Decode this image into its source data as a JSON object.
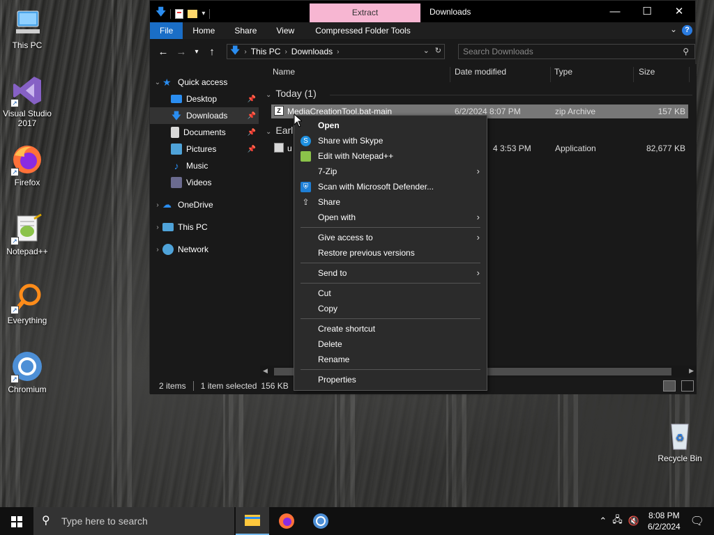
{
  "desktop": {
    "icons": [
      {
        "label": "This PC"
      },
      {
        "label": "Visual Studio 2017"
      },
      {
        "label": "Firefox"
      },
      {
        "label": "Notepad++"
      },
      {
        "label": "Everything"
      },
      {
        "label": "Chromium"
      },
      {
        "label": "Recycle Bin"
      }
    ]
  },
  "explorer": {
    "title": "Downloads",
    "contextual_tab": "Extract",
    "ribbon_tabs": [
      "File",
      "Home",
      "Share",
      "View",
      "Compressed Folder Tools"
    ],
    "breadcrumb": [
      "This PC",
      "Downloads"
    ],
    "search_placeholder": "Search Downloads",
    "nav": {
      "quick_access": "Quick access",
      "items": [
        "Desktop",
        "Downloads",
        "Documents",
        "Pictures",
        "Music",
        "Videos"
      ],
      "onedrive": "OneDrive",
      "this_pc": "This PC",
      "network": "Network"
    },
    "columns": {
      "name": "Name",
      "date": "Date modified",
      "type": "Type",
      "size": "Size"
    },
    "groups": {
      "today": "Today (1)",
      "earlier": "Earl"
    },
    "files": [
      {
        "name": "MediaCreationTool.bat-main",
        "date": "6/2/2024 8:07 PM",
        "type": "zip Archive",
        "size": "157 KB"
      },
      {
        "name": "u",
        "date": "4 3:53 PM",
        "type": "Application",
        "size": "82,677 KB"
      }
    ],
    "status": {
      "items": "2 items",
      "selected": "1 item selected",
      "size": "156 KB"
    }
  },
  "context_menu": {
    "items": {
      "open": "Open",
      "skype": "Share with Skype",
      "notepad": "Edit with Notepad++",
      "zip": "7-Zip",
      "defender": "Scan with Microsoft Defender...",
      "share": "Share",
      "open_with": "Open with",
      "give_access": "Give access to",
      "restore": "Restore previous versions",
      "send_to": "Send to",
      "cut": "Cut",
      "copy": "Copy",
      "create_shortcut": "Create shortcut",
      "delete": "Delete",
      "rename": "Rename",
      "properties": "Properties"
    }
  },
  "taskbar": {
    "search_placeholder": "Type here to search",
    "time": "8:08 PM",
    "date": "6/2/2024"
  },
  "colors": {
    "accent": "#1a6ec7",
    "extract_tab": "#f7b6d2",
    "selected_row": "#777777"
  }
}
